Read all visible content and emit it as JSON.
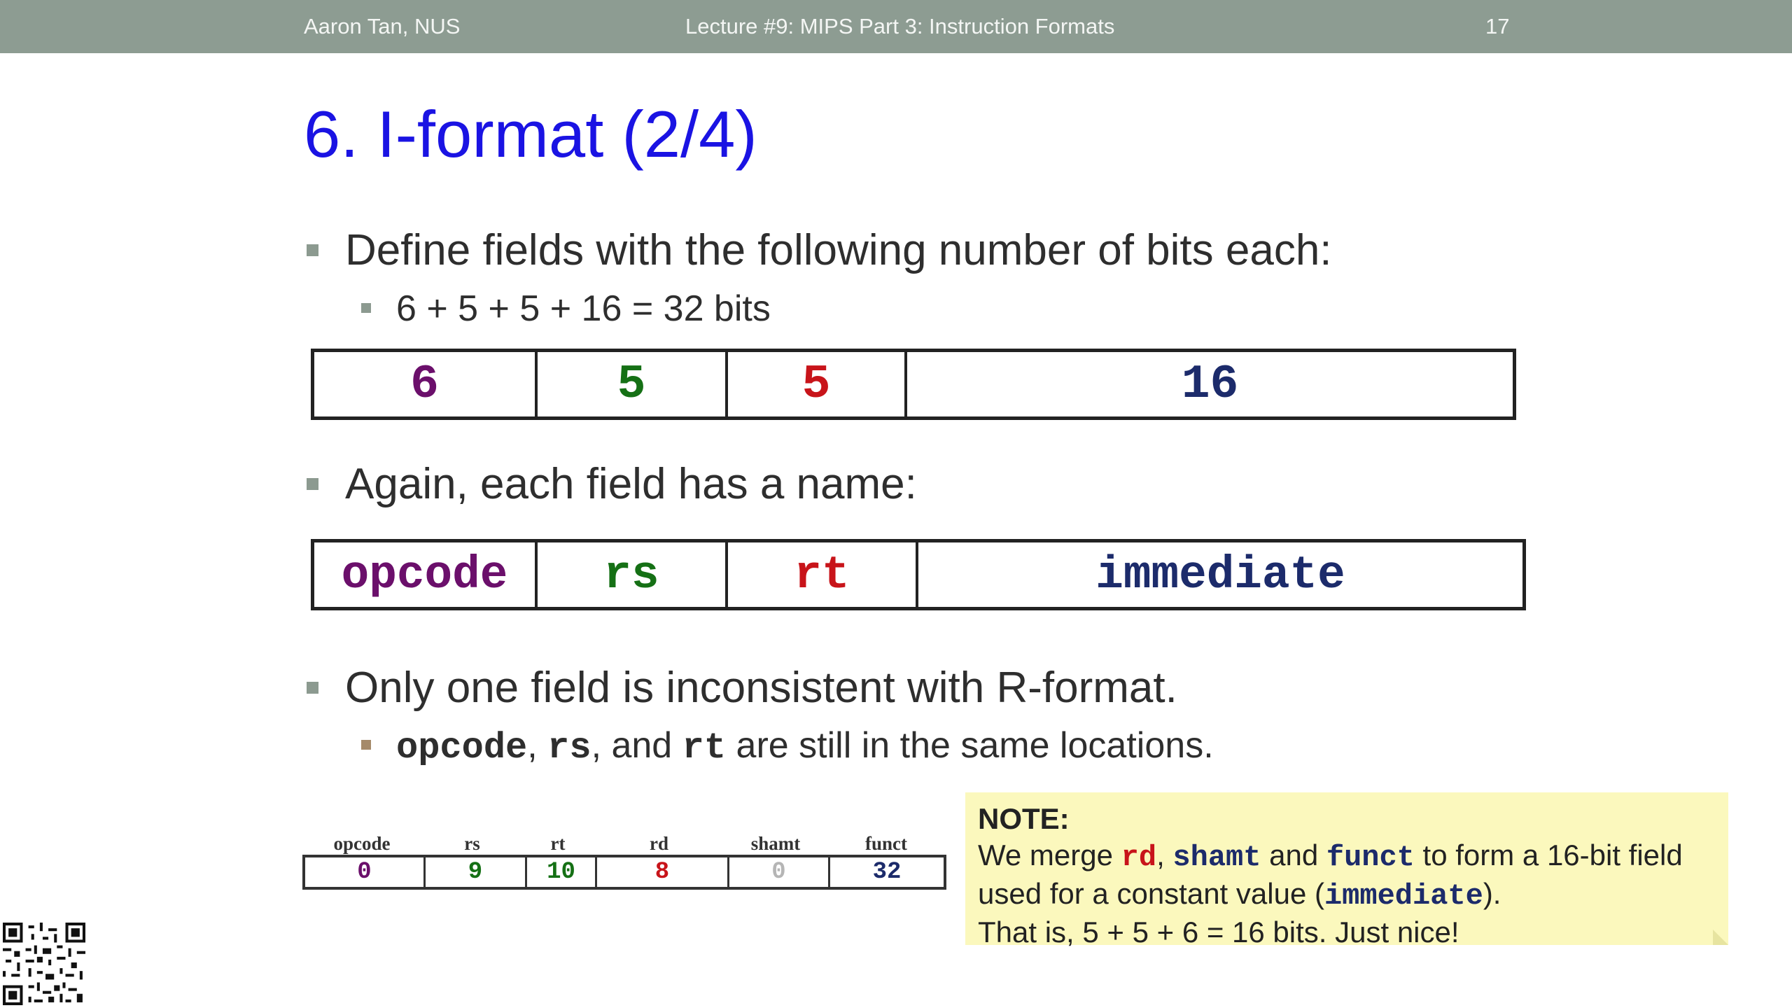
{
  "header": {
    "author": "Aaron Tan, NUS",
    "lecture": "Lecture #9: MIPS Part 3: Instruction Formats",
    "page_number": "17"
  },
  "slide_title": "6. I-format (2/4)",
  "bullets": {
    "b1": "Define fields with the following number of bits each:",
    "b1_sub": "6 + 5 + 5 + 16 = 32 bits",
    "b2": "Again, each field has a name:",
    "b3": "Only one field is inconsistent with R-format.",
    "b3_sub": {
      "opcode": "opcode",
      "comma1": ", ",
      "rs": "rs",
      "and": ", and ",
      "rt": "rt",
      "rest": " are still in the same locations."
    }
  },
  "bit_widths": [
    {
      "text": "6",
      "color": "#6b0f6b"
    },
    {
      "text": "5",
      "color": "#157015"
    },
    {
      "text": "5",
      "color": "#c8141a"
    },
    {
      "text": "16",
      "color": "#1c2b6b"
    }
  ],
  "field_names": [
    {
      "text": "opcode",
      "color": "#6b0f6b"
    },
    {
      "text": "rs",
      "color": "#157015"
    },
    {
      "text": "rt",
      "color": "#c8141a"
    },
    {
      "text": "immediate",
      "color": "#1c2b6b"
    }
  ],
  "r_format_example": {
    "headers": [
      "opcode",
      "rs",
      "rt",
      "rd",
      "shamt",
      "funct"
    ],
    "values": [
      {
        "text": "0",
        "color": "#6b0f6b"
      },
      {
        "text": "9",
        "color": "#157015"
      },
      {
        "text": "10",
        "color": "#157015"
      },
      {
        "text": "8",
        "color": "#c8141a"
      },
      {
        "text": "0",
        "color": "#b5b5b5"
      },
      {
        "text": "32",
        "color": "#1c2b6b"
      }
    ]
  },
  "note": {
    "heading": "NOTE:",
    "l1_a": "We merge ",
    "rd": "rd",
    "l1_b": ", ",
    "shamt": "shamt",
    "l1_c": " and ",
    "funct": "funct",
    "l1_d": " to form a 16-bit field",
    "l2_a": "used for a constant value (",
    "immediate": "immediate",
    "l2_b": ").",
    "l3": "That is, 5 + 5 + 6 = 16 bits.  Just nice!"
  },
  "qr_code": "qr-code"
}
